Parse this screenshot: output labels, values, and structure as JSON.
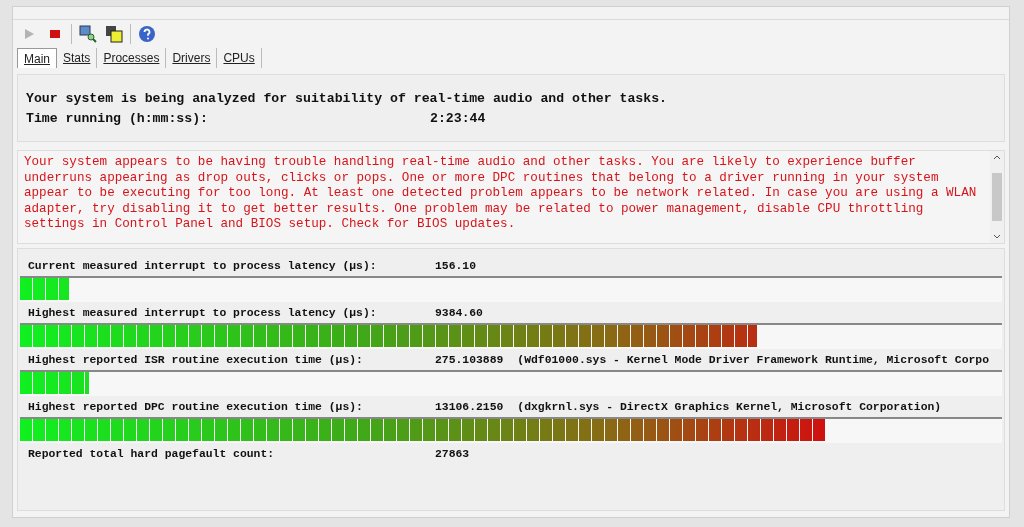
{
  "toolbar": [
    {
      "kind": "play",
      "disabled": true
    },
    {
      "kind": "stop",
      "disabled": false
    },
    {
      "kind": "analyze",
      "disabled": false
    },
    {
      "kind": "windows",
      "disabled": false
    },
    {
      "kind": "help",
      "disabled": false
    }
  ],
  "tabs": [
    {
      "label": "Main",
      "selected": true
    },
    {
      "label": "Stats",
      "selected": false
    },
    {
      "label": "Processes",
      "selected": false
    },
    {
      "label": "Drivers",
      "selected": false
    },
    {
      "label": "CPUs",
      "selected": false
    }
  ],
  "status": {
    "message": "Your system is being analyzed for suitability of real-time audio and other tasks.",
    "time_label": "Time running (h:mm:ss):",
    "time_value": "2:23:44"
  },
  "verdict": "Your system appears to be having trouble handling real-time audio and other tasks. You are likely to experience buffer underruns appearing as drop outs, clicks or pops. One or more DPC routines that belong to a driver running in your system appear to be executing for too long. At least one detected problem appears to be network related. In case you are using a WLAN adapter, try disabling it to get better results. One problem may be related to power management, disable CPU throttling settings in Control Panel and BIOS setup. Check for BIOS updates.",
  "metrics": [
    {
      "kind": "meter",
      "label": "Current measured interrupt to process latency (µs):",
      "value": "156.10",
      "level": 0.05
    },
    {
      "kind": "meter",
      "label": "Highest measured interrupt to process latency (µs):",
      "value": "9384.60",
      "level": 0.75
    },
    {
      "kind": "meter",
      "label": "Highest reported ISR routine execution time (µs):",
      "value": "275.103889",
      "detail": "(Wdf01000.sys - Kernel Mode Driver Framework Runtime, Microsoft Corpo",
      "level": 0.07
    },
    {
      "kind": "meter",
      "label": "Highest reported DPC routine execution time (µs):",
      "value": "13106.2150",
      "detail": "(dxgkrnl.sys - DirectX Graphics Kernel, Microsoft Corporation)",
      "level": 0.82
    },
    {
      "kind": "plain",
      "label": "Reported total hard pagefault count:",
      "value": "27863"
    }
  ]
}
